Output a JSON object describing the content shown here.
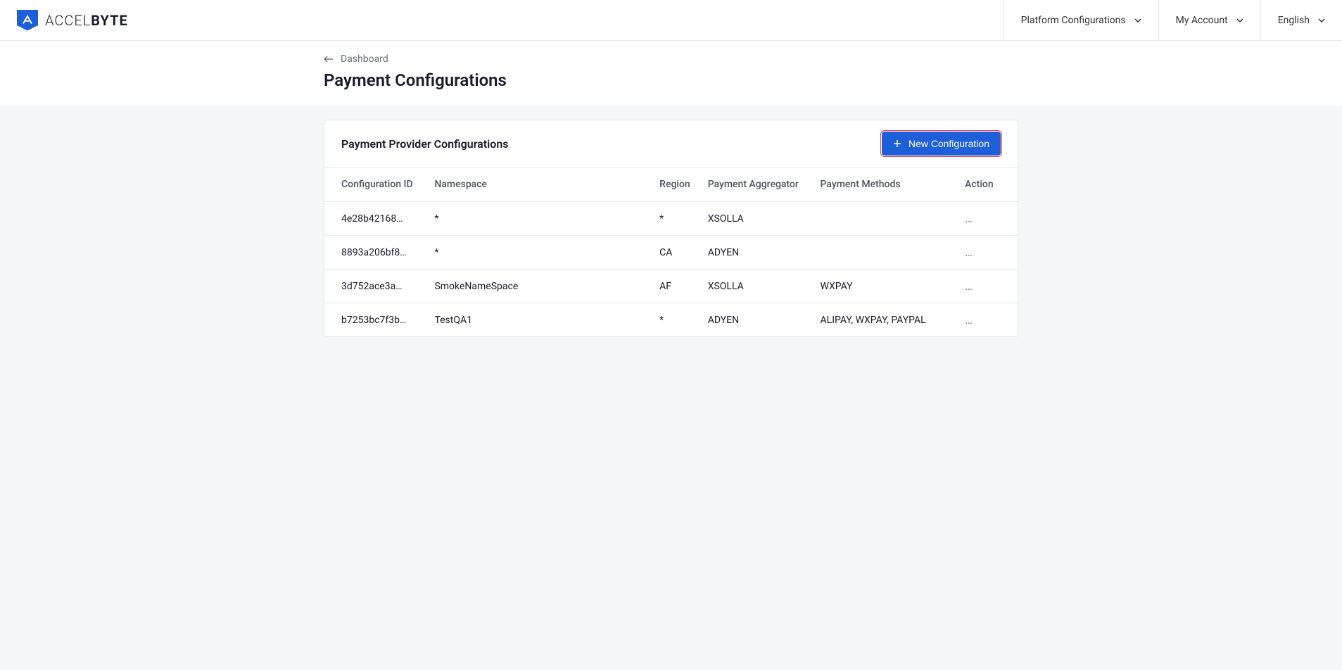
{
  "brand": {
    "name_part1": "ACCEL",
    "name_part2": "BYTE"
  },
  "header_nav": {
    "platform": "Platform Configurations",
    "account": "My Account",
    "language": "English"
  },
  "breadcrumb": {
    "back": "Dashboard"
  },
  "page": {
    "title": "Payment Configurations"
  },
  "card": {
    "title": "Payment Provider Configurations",
    "new_button": "New Configuration"
  },
  "table": {
    "columns": {
      "id": "Configuration ID",
      "namespace": "Namespace",
      "region": "Region",
      "aggregator": "Payment Aggregator",
      "methods": "Payment Methods",
      "action": "Action"
    },
    "rows": [
      {
        "id": "4e28b42168…",
        "namespace": "*",
        "region": "*",
        "aggregator": "XSOLLA",
        "methods": ""
      },
      {
        "id": "8893a206bf8…",
        "namespace": "*",
        "region": "CA",
        "aggregator": "ADYEN",
        "methods": ""
      },
      {
        "id": "3d752ace3a…",
        "namespace": "SmokeNameSpace",
        "region": "AF",
        "aggregator": "XSOLLA",
        "methods": "WXPAY"
      },
      {
        "id": "b7253bc7f3b…",
        "namespace": "TestQA1",
        "region": "*",
        "aggregator": "ADYEN",
        "methods": "ALIPAY, WXPAY, PAYPAL"
      }
    ]
  }
}
